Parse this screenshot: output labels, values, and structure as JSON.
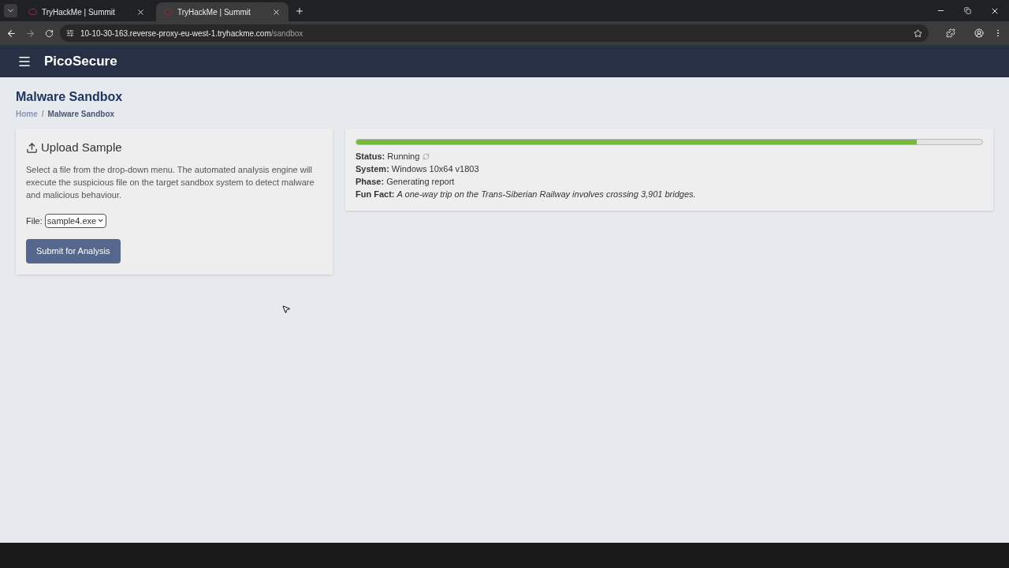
{
  "browser": {
    "tabs": [
      {
        "title": "TryHackMe | Summit",
        "selected": false
      },
      {
        "title": "TryHackMe | Summit",
        "selected": true
      }
    ],
    "url": {
      "host": "10-10-30-163.reverse-proxy-eu-west-1.tryhackme.com",
      "path": "/sandbox"
    }
  },
  "navbar": {
    "brand": "PicoSecure"
  },
  "page": {
    "title": "Malware Sandbox",
    "breadcrumbs": [
      {
        "label": "Home",
        "selected": false
      },
      {
        "label": "Malware Sandbox",
        "selected": true
      }
    ],
    "separator": "/"
  },
  "upload": {
    "title": "Upload Sample",
    "description": "Select a file from the drop-down menu. The automated analysis engine will execute the suspicious file on the target sandbox system to detect malware and malicious behaviour.",
    "file_label": "File:",
    "file_value": "sample4.exe",
    "submit": "Submit for Analysis"
  },
  "analysis": {
    "level": 0.895,
    "lines": [
      {
        "kind": "status",
        "text": "**Status:** Running"
      },
      {
        "kind": "text",
        "text": "**System:** Windows 10x64 v1803"
      },
      {
        "kind": "text",
        "text": "**Phase:** Generating report"
      },
      {
        "kind": "text",
        "text": "**Fun Fact:** *A one-way trip on the Trans-Siberian Railway involves crossing 3,901 bridges.*"
      }
    ]
  }
}
